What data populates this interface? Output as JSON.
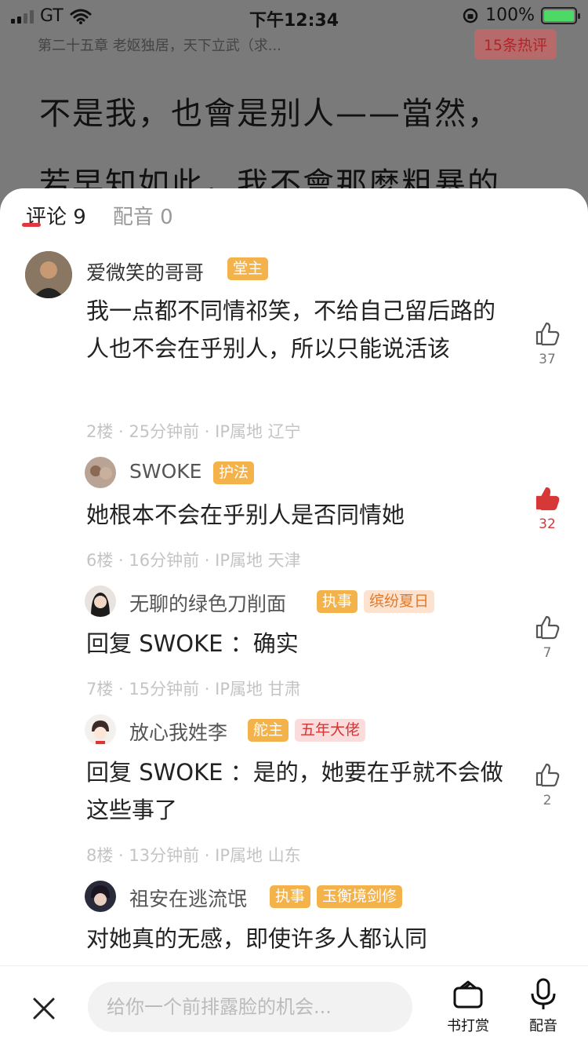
{
  "status": {
    "carrier": "GT",
    "time": "下午12:34",
    "battery": "100%"
  },
  "reader": {
    "chapter_title": "第二十五章 老妪独居，天下立武（求...",
    "hot_comments": "15条热评",
    "line1": "不是我，也會是别人——當然，",
    "line2": "若早知如此，我不會那麼粗暴的"
  },
  "tabs": [
    {
      "label": "评论",
      "count": "9"
    },
    {
      "label": "配音",
      "count": "0"
    }
  ],
  "comments": [
    {
      "username": "爱微笑的哥哥",
      "badges": [
        {
          "text": "堂主",
          "style": "orange"
        }
      ],
      "content": "我一点都不同情祁笑，不给自己留后路的人也不会在乎别人，所以只能说活该",
      "meta": "2楼 · 25分钟前 · IP属地 辽宁",
      "likes": "37",
      "liked": false
    },
    {
      "username": "SWOKE",
      "badges": [
        {
          "text": "护法",
          "style": "orange"
        }
      ],
      "content": "她根本不会在乎别人是否同情她",
      "meta": "6楼 · 16分钟前 · IP属地 天津",
      "likes": "32",
      "liked": true
    },
    {
      "username": "无聊的绿色刀削面",
      "badges": [
        {
          "text": "执事",
          "style": "orange"
        },
        {
          "text": "缤纷夏日",
          "style": "peach"
        }
      ],
      "reply_prefix": "回复 SWOKE ：",
      "content": "确实",
      "meta": "7楼 · 15分钟前 · IP属地 甘肃",
      "likes": "7",
      "liked": false
    },
    {
      "username": "放心我姓李",
      "badges": [
        {
          "text": "舵主",
          "style": "orange"
        },
        {
          "text": "五年大佬",
          "style": "pink"
        }
      ],
      "reply_prefix": "回复 SWOKE ：",
      "content": "是的，她要在乎就不会做这些事了",
      "meta": "8楼 · 13分钟前 · IP属地 山东",
      "likes": "2",
      "liked": false
    },
    {
      "username": "祖安在逃流氓",
      "badges": [
        {
          "text": "执事",
          "style": "orange"
        },
        {
          "text": "玉衡境剑修",
          "style": "orange"
        }
      ],
      "content": "对她真的无感，即使许多人都认同",
      "meta": "",
      "likes": "",
      "liked": false
    }
  ],
  "bottom_bar": {
    "placeholder": "给你一个前排露脸的机会...",
    "reward_label": "书打赏",
    "voice_label": "配音"
  },
  "colors": {
    "accent": "#e0383e",
    "badge_orange": "#f3b24a",
    "liked": "#d63737"
  },
  "icons": [
    "close-icon",
    "wallet-icon",
    "microphone-icon",
    "thumbs-up-icon"
  ]
}
